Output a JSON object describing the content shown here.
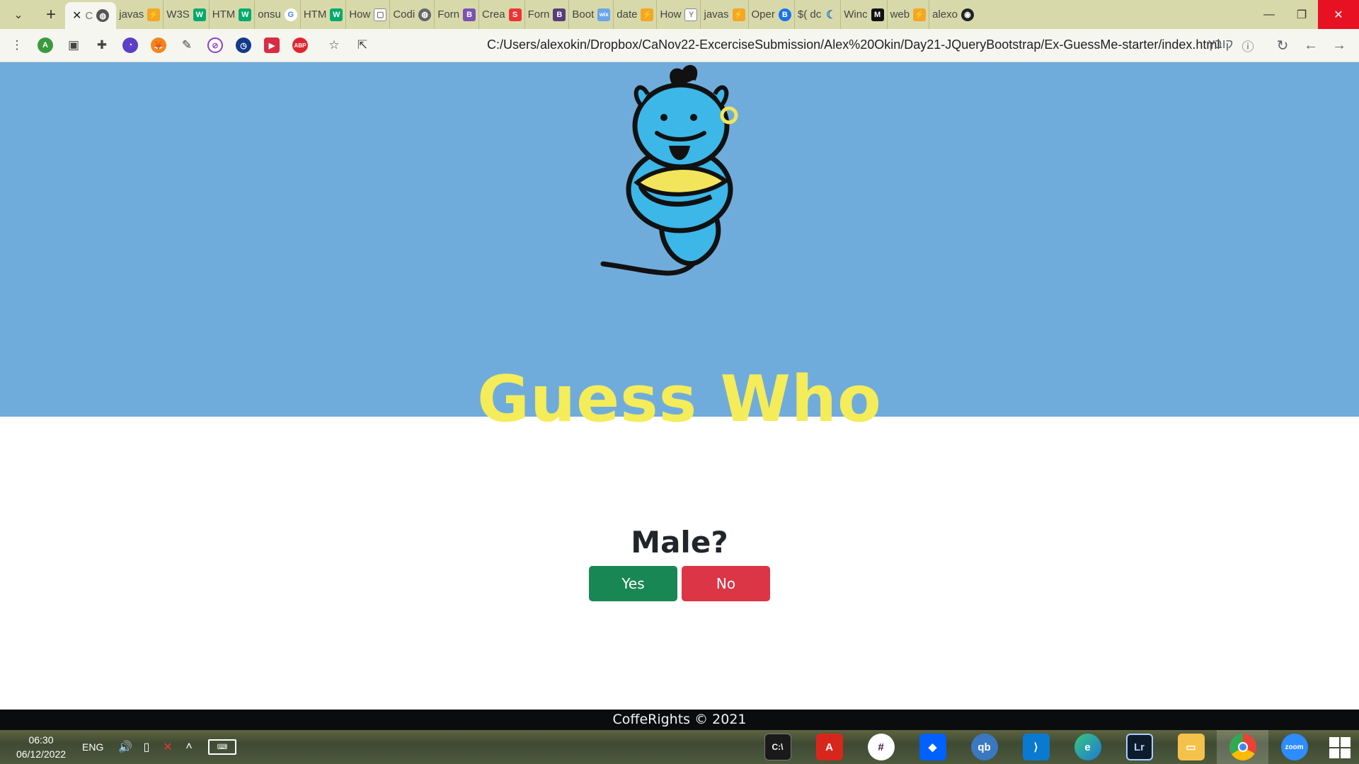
{
  "browser": {
    "tabs": [
      {
        "label": "javas",
        "icon": "orange"
      },
      {
        "label": "W3S",
        "icon": "w3"
      },
      {
        "label": "HTM",
        "icon": "w3"
      },
      {
        "label": "onsu",
        "icon": "google"
      },
      {
        "label": "HTM",
        "icon": "w3"
      },
      {
        "label": "How",
        "icon": "box"
      },
      {
        "label": "Codi",
        "icon": "globe"
      },
      {
        "label": "Forn",
        "icon": "bootstrap"
      },
      {
        "label": "Crea",
        "icon": "s"
      },
      {
        "label": "Forn",
        "icon": "bootstrap"
      },
      {
        "label": "Boot",
        "icon": "wix"
      },
      {
        "label": "date",
        "icon": "orange"
      },
      {
        "label": "How",
        "icon": "y"
      },
      {
        "label": "javas",
        "icon": "orange"
      },
      {
        "label": "Oper",
        "icon": "b-circle"
      },
      {
        "label": "$( dc",
        "icon": "moon"
      },
      {
        "label": "Winc",
        "icon": "medium"
      },
      {
        "label": "web",
        "icon": "orange"
      },
      {
        "label": "alexo",
        "icon": "github"
      }
    ],
    "active_tab_label": "C",
    "url": "C:/Users/alexokin/Dropbox/CaNov22-ExcerciseSubmission/Alex%20Okin/Day21-JQueryBootstrap/Ex-GuessMe-starter/index.html",
    "url_badge": "קובץ",
    "profile_initial": "A",
    "ext_abp": "ABP"
  },
  "page": {
    "title": "Guess Who",
    "question": "Male?",
    "yes_label": "Yes",
    "no_label": "No",
    "footer": "CoffeRights © 2021"
  },
  "taskbar": {
    "time": "06:30",
    "date": "06/12/2022",
    "lang": "ENG",
    "apps": [
      "terminal",
      "acrobat",
      "slack",
      "dropbox",
      "qbittorrent",
      "vscode",
      "edge",
      "lightroom",
      "explorer",
      "chrome",
      "zoom"
    ],
    "qb_label": "qb",
    "lr_label": "Lr",
    "zoom_label": "zoom"
  },
  "colors": {
    "hero": "#70acdb",
    "title": "#f5ec5a",
    "yes": "#198754",
    "no": "#dc3545",
    "tabstrip": "#d7d9aa"
  }
}
